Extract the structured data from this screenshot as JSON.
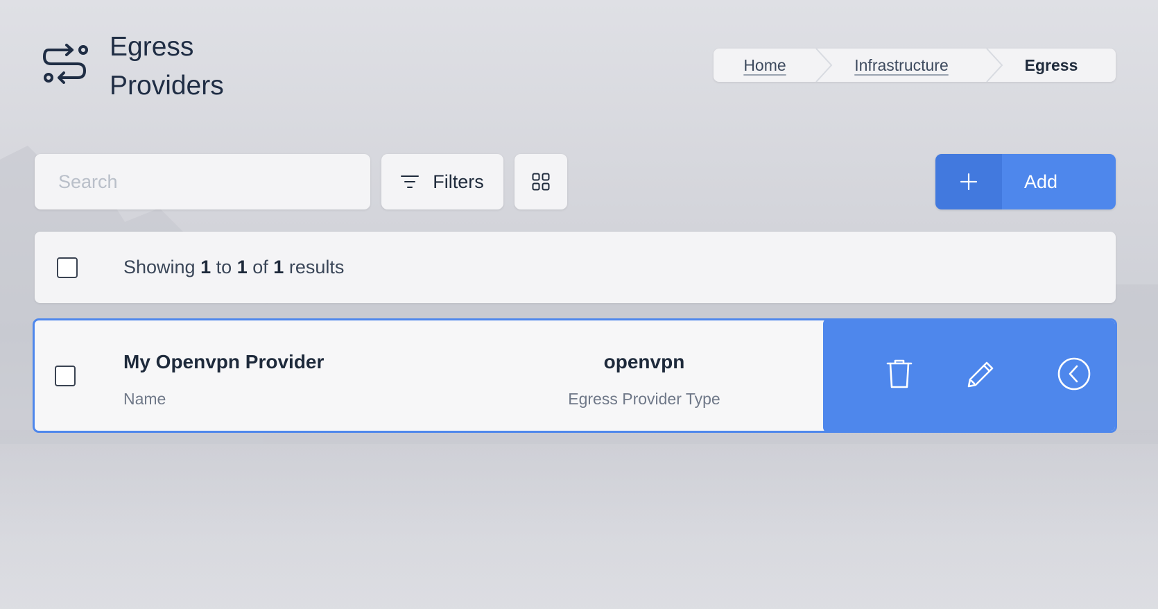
{
  "header": {
    "icon": "route-icon",
    "title": "Egress Providers"
  },
  "breadcrumb": {
    "items": [
      {
        "label": "Home"
      },
      {
        "label": "Infrastructure"
      },
      {
        "label": "Egress"
      }
    ]
  },
  "toolbar": {
    "search_placeholder": "Search",
    "search_value": "",
    "filters_label": "Filters",
    "filters_icon": "filter-lines-icon",
    "view_icon": "grid-view-icon",
    "add_label": "Add",
    "add_icon": "plus-icon"
  },
  "results": {
    "prefix": "Showing",
    "from": "1",
    "to_word": "to",
    "to": "1",
    "of_word": "of",
    "total": "1",
    "suffix": "results"
  },
  "rows": [
    {
      "name": "My Openvpn Provider",
      "name_label": "Name",
      "type": "openvpn",
      "type_label": "Egress Provider Type",
      "actions": [
        "trash-icon",
        "pencil-icon",
        "chevron-left-circle-icon"
      ]
    }
  ],
  "colors": {
    "accent": "#4e87ec",
    "accent_dark": "#4279de",
    "text": "#1e2a3b",
    "muted": "#6f7888"
  }
}
